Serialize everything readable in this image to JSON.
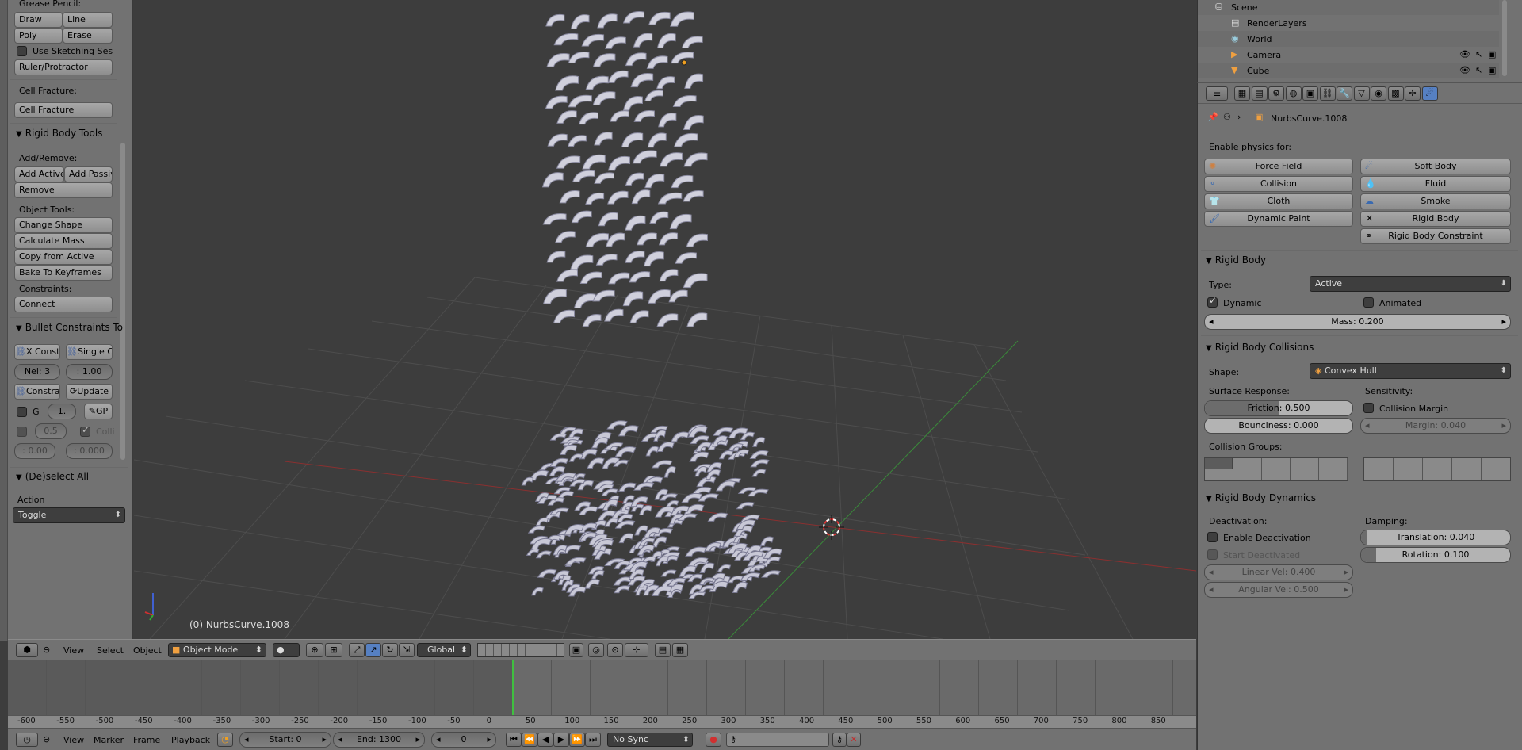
{
  "toolshelf": {
    "grease_pencil": {
      "header": "Grease Pencil:",
      "draw": "Draw",
      "line": "Line",
      "poly": "Poly",
      "erase": "Erase",
      "sketch": "Use Sketching Sessi",
      "ruler": "Ruler/Protractor"
    },
    "cell_fracture": {
      "header": "Cell Fracture:",
      "button": "Cell Fracture"
    },
    "rigid_body_tools": {
      "title": "Rigid Body Tools",
      "add_remove": "Add/Remove:",
      "add_active": "Add Active",
      "add_passive": "Add Passiv",
      "remove": "Remove",
      "object_tools": "Object Tools:",
      "change_shape": "Change Shape",
      "calculate_mass": "Calculate Mass",
      "copy_from_active": "Copy from Active",
      "bake": "Bake To Keyframes",
      "constraints": "Constraints:",
      "connect": "Connect"
    },
    "bullet": {
      "title": "Bullet Constraints To",
      "x_const": "X Const",
      "single": "Single C",
      "nei": "Nei: 3",
      "val1": ": 1.00",
      "constra": "Constra",
      "update": "Update",
      "g": "G",
      "one": "1.",
      "gp": "GP",
      "half": "0.5",
      "colli": "Colli",
      "zero1": ": 0.00",
      "zero2": ": 0.000"
    },
    "deselect": {
      "title": "(De)select All",
      "action": "Action",
      "value": "Toggle"
    }
  },
  "viewport": {
    "object_label": "(0) NurbsCurve.1008"
  },
  "view_header": {
    "view": "View",
    "select": "Select",
    "object": "Object",
    "mode": "Object Mode",
    "orientation": "Global"
  },
  "timeline": {
    "ticks": [
      "-600",
      "-550",
      "-500",
      "-450",
      "-400",
      "-350",
      "-300",
      "-250",
      "-200",
      "-150",
      "-100",
      "-50",
      "0",
      "50",
      "100",
      "150",
      "200",
      "250",
      "300",
      "350",
      "400",
      "450",
      "500",
      "550",
      "600",
      "650",
      "700",
      "750",
      "800",
      "850"
    ],
    "view": "View",
    "marker": "Marker",
    "frame": "Frame",
    "playback": "Playback",
    "start": "Start: 0",
    "end": "End: 1300",
    "current": "0",
    "sync": "No Sync"
  },
  "outliner": {
    "items": [
      {
        "name": "Scene"
      },
      {
        "name": "RenderLayers"
      },
      {
        "name": "World"
      },
      {
        "name": "Camera"
      },
      {
        "name": "Cube"
      }
    ]
  },
  "properties": {
    "object_name": "NurbsCurve.1008",
    "enable_physics": "Enable physics for:",
    "physics_buttons": {
      "force_field": "Force Field",
      "soft_body": "Soft Body",
      "collision": "Collision",
      "fluid": "Fluid",
      "cloth": "Cloth",
      "smoke": "Smoke",
      "dynamic_paint": "Dynamic Paint",
      "rigid_body": "Rigid Body",
      "rigid_body_constraint": "Rigid Body Constraint"
    },
    "rigid_body": {
      "title": "Rigid Body",
      "type_label": "Type:",
      "type_value": "Active",
      "dynamic": "Dynamic",
      "animated": "Animated",
      "mass": "Mass: 0.200"
    },
    "collisions": {
      "title": "Rigid Body Collisions",
      "shape_label": "Shape:",
      "shape_value": "Convex Hull",
      "surface": "Surface Response:",
      "sensitivity": "Sensitivity:",
      "friction": "Friction: 0.500",
      "friction_frac": 0.5,
      "bounciness": "Bounciness: 0.000",
      "bounciness_frac": 0.0,
      "collision_margin": "Collision Margin",
      "margin": "Margin: 0.040",
      "groups": "Collision Groups:"
    },
    "dynamics": {
      "title": "Rigid Body Dynamics",
      "deactivation": "Deactivation:",
      "damping": "Damping:",
      "enable_deactivation": "Enable Deactivation",
      "start_deactivated": "Start Deactivated",
      "translation": "Translation: 0.040",
      "translation_frac": 0.04,
      "rotation": "Rotation: 0.100",
      "rotation_frac": 0.1,
      "linear_vel": "Linear Vel: 0.400",
      "angular_vel": "Angular Vel: 0.500"
    }
  },
  "colors": {
    "viewport_bg": "#3d3d3d",
    "panel_bg": "#727272",
    "active_blue": "#5680c2",
    "frame_green": "#40c040"
  }
}
